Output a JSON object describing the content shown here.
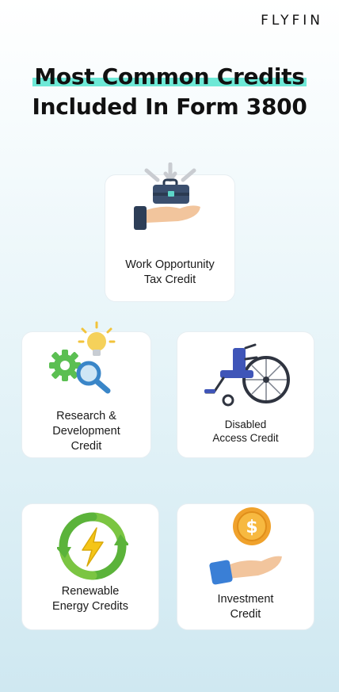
{
  "brand": "FLYFIN",
  "title": {
    "line1": "Most Common Credits",
    "line2": "Included In Form 3800"
  },
  "cards": [
    {
      "icon": "briefcase-hand-icon",
      "label_lines": [
        "Work Opportunity",
        "Tax Credit"
      ]
    },
    {
      "icon": "gear-bulb-magnifier-icon",
      "label_lines": [
        "Research &",
        "Development",
        "Credit"
      ]
    },
    {
      "icon": "wheelchair-icon",
      "label_lines": [
        "Disabled",
        "Access Credit"
      ]
    },
    {
      "icon": "renewable-energy-icon",
      "label_lines": [
        "Renewable",
        "Energy Credits"
      ]
    },
    {
      "icon": "coin-hand-icon",
      "label_lines": [
        "Investment",
        "Credit"
      ]
    }
  ]
}
